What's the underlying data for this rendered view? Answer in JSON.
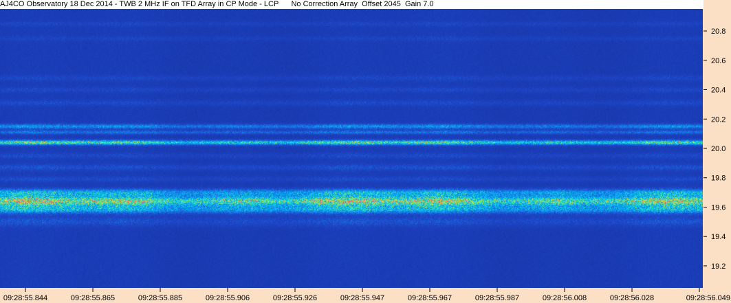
{
  "header": {
    "observatory": "AJ4CO Observatory 18 Dec 2014 - TWB 2 MHz IF on TFD Array in CP Mode - LCP",
    "correction": "No Correction Array",
    "offset": "Offset 2045",
    "gain": "Gain 7.0"
  },
  "colors": {
    "background": "#fbe0c6",
    "title_bg": "#ffffff",
    "low_intensity": "#1a3fb0",
    "mid_intensity": "#00c8ff",
    "high_intensity": "#e0e020",
    "peak_intensity": "#ff4060"
  },
  "chart_data": {
    "type": "heatmap",
    "x_tick_labels": [
      "09:28:55.844",
      "09:28:55.865",
      "09:28:55.885",
      "09:28:55.906",
      "09:28:55.926",
      "09:28:55.947",
      "09:28:55.967",
      "09:28:55.987",
      "09:28:56.008",
      "09:28:56.028",
      "09:28:56.049"
    ],
    "y_ticks": [
      19.2,
      19.4,
      19.6,
      19.8,
      20.0,
      20.2,
      20.4,
      20.6,
      20.8
    ],
    "y_tick_labels": [
      "19.2",
      "19.4",
      "19.6",
      "19.8",
      "20.0",
      "20.2",
      "20.4",
      "20.6",
      "20.8"
    ],
    "ylim": [
      19.05,
      20.95
    ],
    "emission_bands": [
      {
        "freq": 20.85,
        "intensity": 0.12,
        "width": 0.012
      },
      {
        "freq": 20.75,
        "intensity": 0.12,
        "width": 0.012
      },
      {
        "freq": 20.48,
        "intensity": 0.14,
        "width": 0.014
      },
      {
        "freq": 20.4,
        "intensity": 0.14,
        "width": 0.014
      },
      {
        "freq": 20.31,
        "intensity": 0.16,
        "width": 0.014
      },
      {
        "freq": 20.15,
        "intensity": 0.5,
        "width": 0.012
      },
      {
        "freq": 20.11,
        "intensity": 0.38,
        "width": 0.01
      },
      {
        "freq": 20.04,
        "intensity": 0.85,
        "width": 0.012
      },
      {
        "freq": 19.95,
        "intensity": 0.16,
        "width": 0.014
      },
      {
        "freq": 19.87,
        "intensity": 0.2,
        "width": 0.016
      },
      {
        "freq": 19.79,
        "intensity": 0.16,
        "width": 0.014
      },
      {
        "freq": 19.7,
        "intensity": 0.55,
        "width": 0.018
      },
      {
        "freq": 19.64,
        "intensity": 0.95,
        "width": 0.028
      },
      {
        "freq": 19.58,
        "intensity": 0.55,
        "width": 0.02
      },
      {
        "freq": 19.5,
        "intensity": 0.22,
        "width": 0.025
      }
    ]
  }
}
